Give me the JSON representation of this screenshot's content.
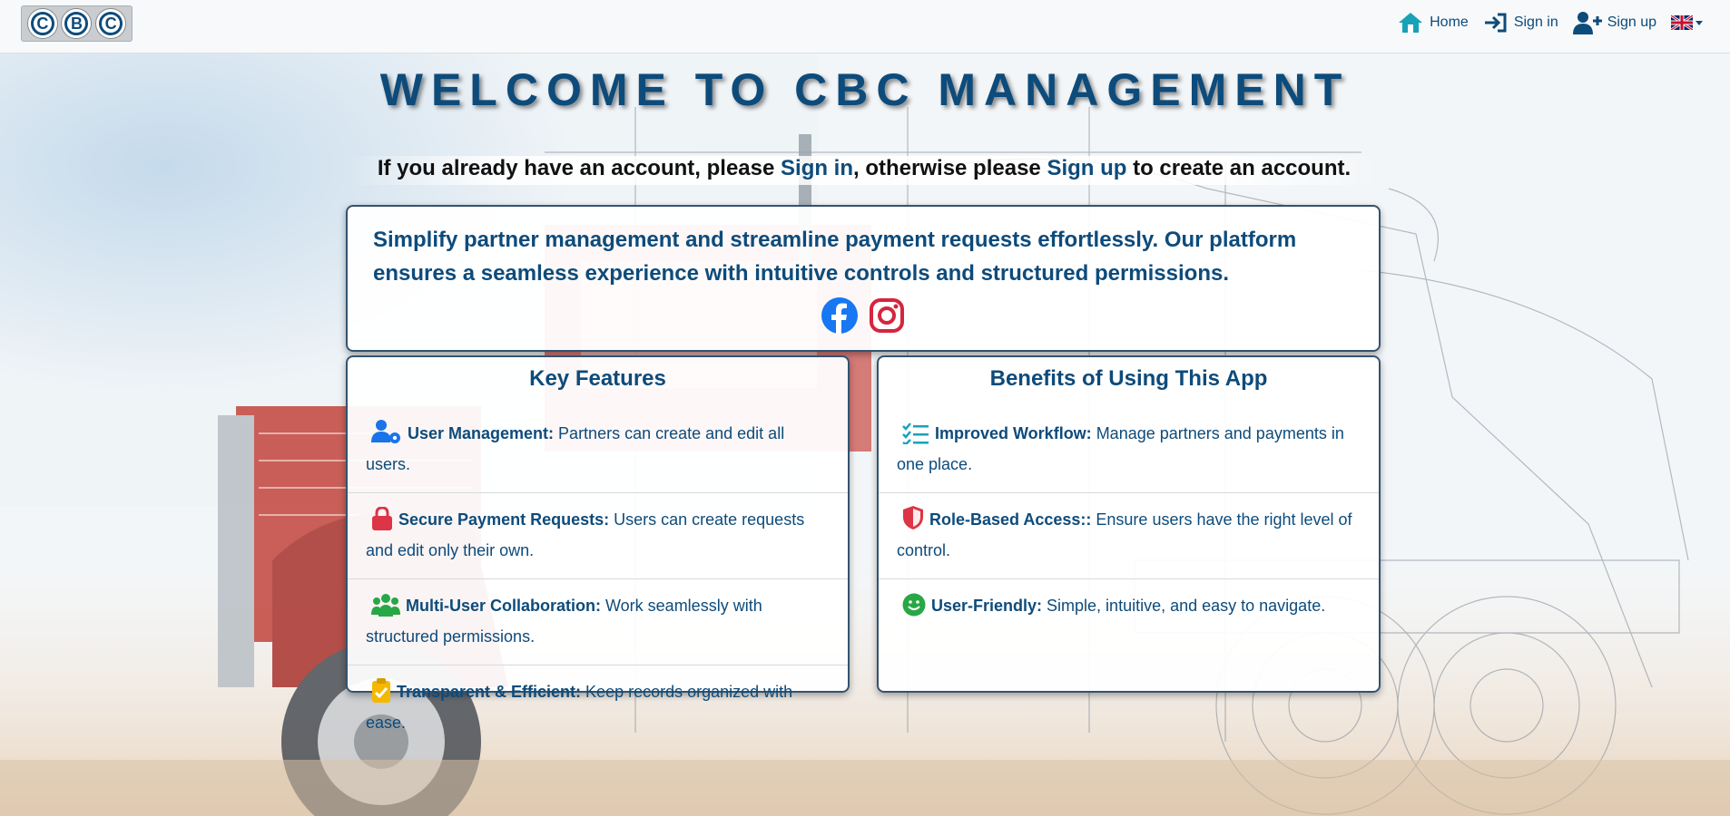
{
  "nav": {
    "logo_letters": [
      "C",
      "B",
      "C"
    ],
    "home": "Home",
    "signin": "Sign in",
    "signup": "Sign up",
    "language_icon": "uk-flag-icon"
  },
  "hero": {
    "title": "WELCOME TO CBC MANAGEMENT",
    "intro_prefix": "If you already have an account, please ",
    "intro_signin": "Sign in",
    "intro_middle": ", otherwise please ",
    "intro_signup": "Sign up",
    "intro_suffix": " to create an account."
  },
  "about": {
    "text": "Simplify partner management and streamline payment requests effortlessly. Our platform ensures a seamless experience with intuitive controls and structured permissions."
  },
  "features": {
    "title": "Key Features",
    "items": [
      {
        "icon": "user-gear-icon",
        "title": "User Management:",
        "text": " Partners can create and edit all users."
      },
      {
        "icon": "lock-icon",
        "title": "Secure Payment Requests:",
        "text": " Users can create requests and edit only their own."
      },
      {
        "icon": "people-icon",
        "title": "Multi-User Collaboration:",
        "text": " Work seamlessly with structured permissions."
      },
      {
        "icon": "clipboard-check-icon",
        "title": "Transparent & Efficient:",
        "text": " Keep records organized with ease."
      }
    ]
  },
  "benefits": {
    "title": "Benefits of Using This App",
    "items": [
      {
        "icon": "list-check-icon",
        "title": "Improved Workflow:",
        "text": " Manage partners and payments in one place."
      },
      {
        "icon": "shield-icon",
        "title": "Role-Based Access::",
        "text": " Ensure users have the right level of control."
      },
      {
        "icon": "smile-icon",
        "title": "User-Friendly:",
        "text": " Simple, intuitive, and easy to navigate."
      }
    ]
  },
  "colors": {
    "primary": "#0d4b7b",
    "facebook": "#1877f2",
    "instagram": "#d6253f",
    "lock": "#dc3545",
    "green": "#28a745",
    "gold": "#f5b800",
    "teal": "#17a2b8"
  }
}
